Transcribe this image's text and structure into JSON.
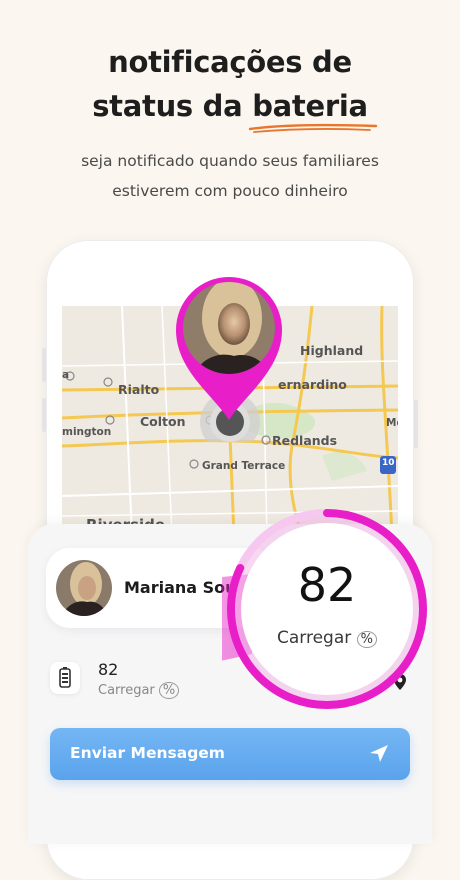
{
  "header": {
    "title_line1": "notificações de",
    "title_line2_prefix": "status da ",
    "title_highlight": "bateria",
    "subtitle_line1": "seja notificado quando seus familiares",
    "subtitle_line2": "estiverem com pouco dinheiro",
    "accent_color": "#e8762c"
  },
  "map": {
    "labels": {
      "highland": "Highland",
      "rialto": "Rialto",
      "bernardino": "ernardino",
      "colton": "Colton",
      "redlands": "Redlands",
      "mington": "mington",
      "grand_terrace": "Grand Terrace",
      "riverside": "Riverside",
      "mo": "Mo",
      "edge_a": "a",
      "shield_10": "10"
    }
  },
  "pin": {
    "color": "#e81ec9",
    "icon": "location-pin-icon"
  },
  "person": {
    "name": "Mariana Sou"
  },
  "battery": {
    "value": "82",
    "label": "Carregar",
    "percent_symbol": "%",
    "level_percent": 82,
    "icon": "battery-icon"
  },
  "action": {
    "send_message": "Enviar Mensagem",
    "icon": "send-arrow-icon"
  },
  "colors": {
    "button": "#62a8ee",
    "ring": "#e81ec9"
  }
}
